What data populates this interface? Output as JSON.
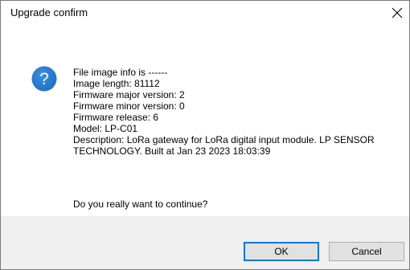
{
  "window": {
    "title": "Upgrade confirm",
    "close_symbol": "✕"
  },
  "icons": {
    "info": "question-mark-icon",
    "info_glyph": "?",
    "cursor": "mouse-pointer-icon",
    "accent": "#1c6fc1"
  },
  "message": {
    "lines": [
      "File image info is ------",
      "Image length: 81112",
      "Firmware major version: 2",
      "Firmware minor version: 0",
      "Firmware release: 6",
      "Model: LP-C01",
      "Description: LoRa gateway for LoRa digital input module. LP SENSOR TECHNOLOGY. Built at Jan 23 2023 18:03:39"
    ],
    "question": "Do you really want to continue?"
  },
  "buttons": {
    "ok": "OK",
    "cancel": "Cancel"
  }
}
